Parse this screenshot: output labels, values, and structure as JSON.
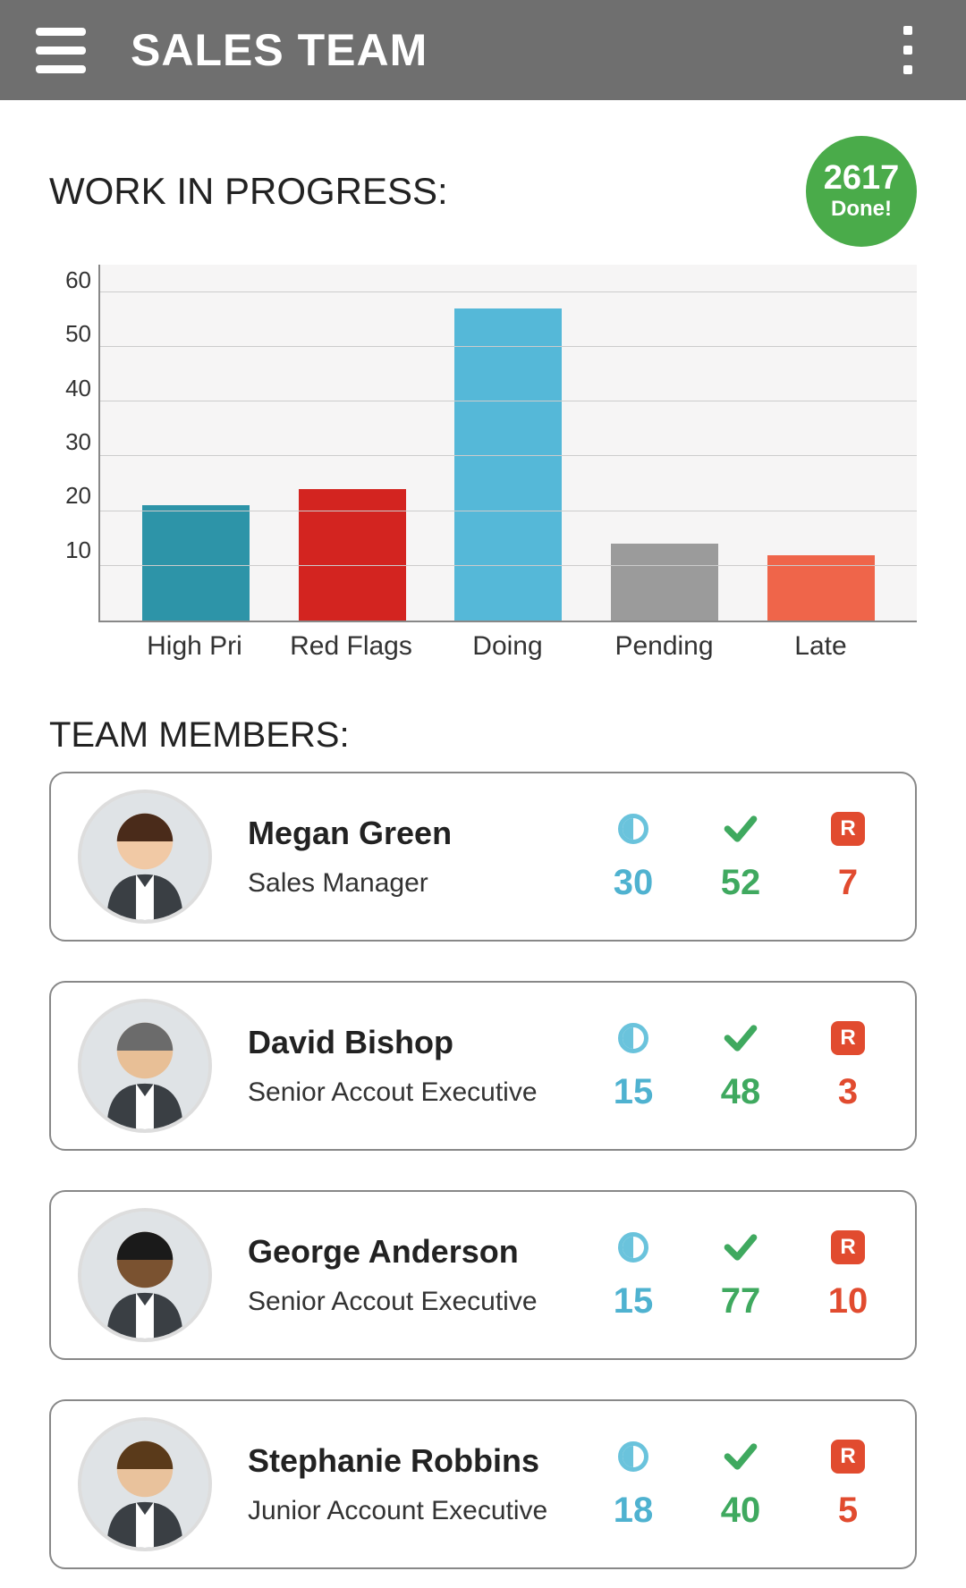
{
  "header": {
    "title": "SALES TEAM"
  },
  "wip": {
    "title": "WORK IN PROGRESS:",
    "done_count": "2617",
    "done_label": "Done!"
  },
  "chart_data": {
    "type": "bar",
    "categories": [
      "High Pri",
      "Red Flags",
      "Doing",
      "Pending",
      "Late"
    ],
    "values": [
      21,
      24,
      57,
      14,
      12
    ],
    "colors": [
      "#2d94a8",
      "#d32420",
      "#55b8d8",
      "#9b9b9b",
      "#ef654a"
    ],
    "ylabel": "",
    "xlabel": "",
    "ylim": [
      0,
      65
    ],
    "y_ticks": [
      60,
      50,
      40,
      30,
      20,
      10
    ]
  },
  "team_section_title": "TEAM MEMBERS:",
  "stat_icons": {
    "r_badge_label": "R"
  },
  "members": [
    {
      "name": "Megan Green",
      "role": "Sales Manager",
      "half": "30",
      "done": "52",
      "red": "7"
    },
    {
      "name": "David Bishop",
      "role": "Senior Accout Executive",
      "half": "15",
      "done": "48",
      "red": "3"
    },
    {
      "name": "George Anderson",
      "role": "Senior Accout Executive",
      "half": "15",
      "done": "77",
      "red": "10"
    },
    {
      "name": "Stephanie Robbins",
      "role": "Junior Account Executive",
      "half": "18",
      "done": "40",
      "red": "5"
    }
  ]
}
